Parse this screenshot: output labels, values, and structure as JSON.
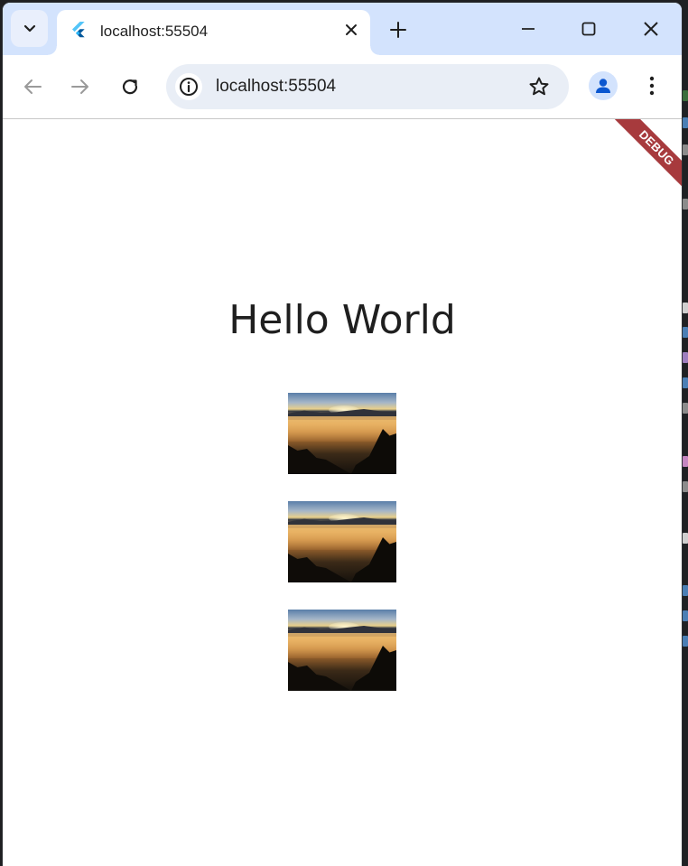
{
  "browser": {
    "tab": {
      "title": "localhost:55504"
    },
    "address_bar": {
      "url": "localhost:55504"
    },
    "colors": {
      "titlebar": "#d3e3fd",
      "omnibox": "#e9eef6",
      "profile_accent": "#0b57d0"
    }
  },
  "page": {
    "heading": "Hello World",
    "debug_banner": "DEBUG",
    "images": [
      {
        "icon": "landscape-sunrise-photo"
      },
      {
        "icon": "landscape-sunrise-photo"
      },
      {
        "icon": "landscape-sunrise-photo"
      }
    ]
  }
}
